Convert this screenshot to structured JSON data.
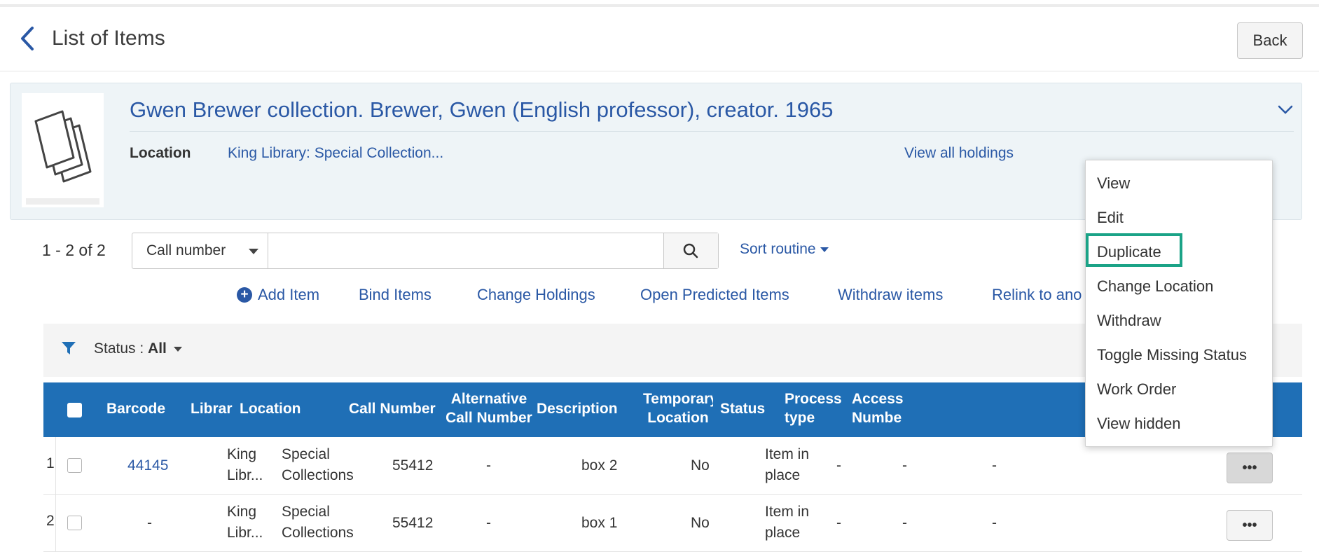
{
  "header": {
    "title": "List of Items",
    "back_label": "Back"
  },
  "record": {
    "title": "Gwen Brewer collection. Brewer, Gwen (English professor), creator. 1965",
    "location_label": "Location",
    "location_value": "King Library: Special Collection...",
    "view_all_holdings": "View all holdings"
  },
  "search": {
    "count": "1 - 2 of 2",
    "field_selected": "Call number",
    "value": "",
    "sort_label": "Sort routine"
  },
  "actions": [
    "Add Item",
    "Bind Items",
    "Change Holdings",
    "Open Predicted Items",
    "Withdraw items",
    "Relink to ano"
  ],
  "filter": {
    "label": "Status : ",
    "value": "All"
  },
  "table": {
    "headers": {
      "barcode": "Barcode",
      "library": "Librar",
      "location": "Location",
      "call_number": "Call Number",
      "alt_call_1": "Alternative",
      "alt_call_2": "Call Number",
      "description": "Description",
      "temp_loc_1": "Temporary",
      "temp_loc_2": "Location",
      "status": "Status",
      "process_1": "Process",
      "process_2": "type",
      "access_1": "Access",
      "access_2": "Numbe"
    },
    "rows": [
      {
        "num": "1",
        "barcode": "44145",
        "library_1": "King",
        "library_2": "Libr...",
        "location_1": "Special",
        "location_2": "Collections",
        "call_number": "55412",
        "alt_call_number": "-",
        "description": "box 2",
        "temporary_location": "No",
        "status_1": "Item in",
        "status_2": "place",
        "process_type": "-",
        "access_number": "-",
        "extra": "-",
        "menu_button": "•••"
      },
      {
        "num": "2",
        "barcode": "-",
        "library_1": "King",
        "library_2": "Libr...",
        "location_1": "Special",
        "location_2": "Collections",
        "call_number": "55412",
        "alt_call_number": "-",
        "description": "box 1",
        "temporary_location": "No",
        "status_1": "Item in",
        "status_2": "place",
        "process_type": "-",
        "access_number": "-",
        "extra": "-",
        "menu_button": "•••"
      }
    ]
  },
  "menu": {
    "items": [
      "View",
      "Edit",
      "Duplicate",
      "Change Location",
      "Withdraw",
      "Toggle Missing Status",
      "Work Order",
      "View hidden"
    ],
    "highlighted": "Duplicate",
    "highlight_color": "#1ba387"
  },
  "colors": {
    "link": "#2a58a5",
    "table_header": "#1f6fb6",
    "record_bg": "#eef4f7"
  }
}
